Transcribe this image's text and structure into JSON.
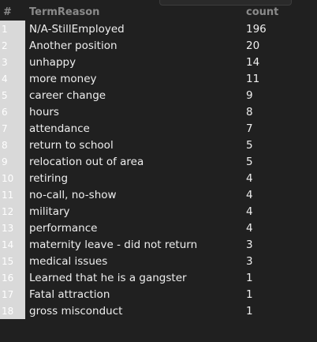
{
  "table": {
    "headers": {
      "index": "#",
      "reason": "TermReason",
      "count": "count"
    },
    "rows": [
      {
        "index": "1",
        "reason": "N/A-StillEmployed",
        "count": "196"
      },
      {
        "index": "2",
        "reason": "Another position",
        "count": "20"
      },
      {
        "index": "3",
        "reason": "unhappy",
        "count": "14"
      },
      {
        "index": "4",
        "reason": "more money",
        "count": "11"
      },
      {
        "index": "5",
        "reason": "career change",
        "count": "9"
      },
      {
        "index": "6",
        "reason": "hours",
        "count": "8"
      },
      {
        "index": "7",
        "reason": "attendance",
        "count": "7"
      },
      {
        "index": "8",
        "reason": "return to school",
        "count": "5"
      },
      {
        "index": "9",
        "reason": "relocation out of area",
        "count": "5"
      },
      {
        "index": "10",
        "reason": "retiring",
        "count": "4"
      },
      {
        "index": "11",
        "reason": "no-call, no-show",
        "count": "4"
      },
      {
        "index": "12",
        "reason": "military",
        "count": "4"
      },
      {
        "index": "13",
        "reason": "performance",
        "count": "4"
      },
      {
        "index": "14",
        "reason": "maternity leave - did not return",
        "count": "3"
      },
      {
        "index": "15",
        "reason": "medical issues",
        "count": "3"
      },
      {
        "index": "16",
        "reason": "Learned that he is a gangster",
        "count": "1"
      },
      {
        "index": "17",
        "reason": "Fatal attraction",
        "count": "1"
      },
      {
        "index": "18",
        "reason": "gross misconduct",
        "count": "1"
      }
    ]
  }
}
